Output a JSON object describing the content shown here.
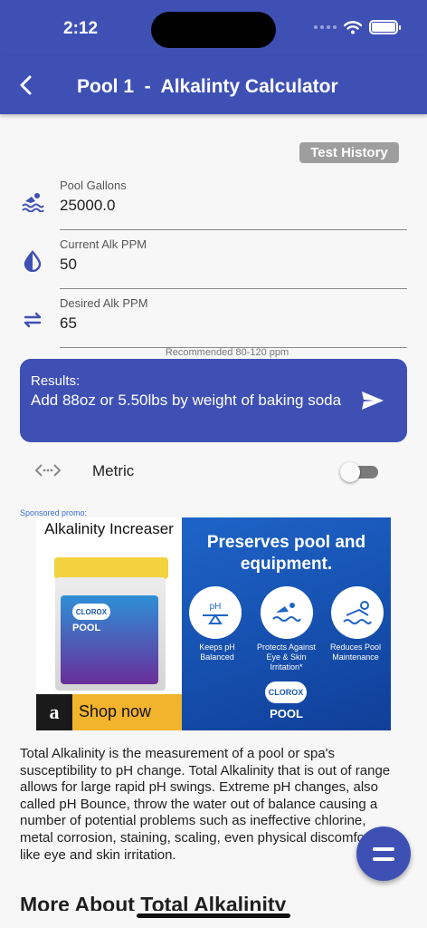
{
  "status_bar": {
    "time": "2:12"
  },
  "app_bar": {
    "title": "Pool 1  -  Alkalinty Calculator"
  },
  "actions": {
    "test_history": "Test History"
  },
  "fields": [
    {
      "label": "Pool Gallons",
      "value": "25000.0",
      "icon": "swimmer-icon"
    },
    {
      "label": "Current Alk PPM",
      "value": "50",
      "icon": "water-drop-icon"
    },
    {
      "label": "Desired Alk PPM",
      "value": "65",
      "icon": "swap-arrows-icon"
    }
  ],
  "hint": "Recommended 80-120 ppm",
  "results": {
    "label": "Results:",
    "text": "Add 88oz or 5.50lbs by weight of baking soda"
  },
  "metric": {
    "label": "Metric",
    "enabled": false
  },
  "sponsor": {
    "label": "Sponsored promo:"
  },
  "ad": {
    "product_title": "Alkalinity Increaser",
    "brand": "CLOROX",
    "pool": "POOL",
    "shop_logo": "a",
    "shop_label": "Shop now",
    "headline": "Preserves pool and equipment.",
    "captions": [
      "Keeps pH Balanced",
      "Protects Against Eye & Skin Irritation*",
      "Reduces Pool Maintenance"
    ]
  },
  "description": "Total Alkalinity is the measurement of a pool or spa's susceptibility to pH change. Total Alkalinity that is out of range allows for large rapid pH swings. Extreme pH changes, also called pH Bounce, throw the water out of balance causing a number of potential problems such as ineffective chlorine, metal corrosion, staining, scaling, even physical discomfort like eye and skin irritation.",
  "section_heading": "More About Total Alkalinity",
  "colors": {
    "primary": "#3f50b5",
    "background": "#f7f7f7",
    "history_button": "#9e9e9e"
  }
}
